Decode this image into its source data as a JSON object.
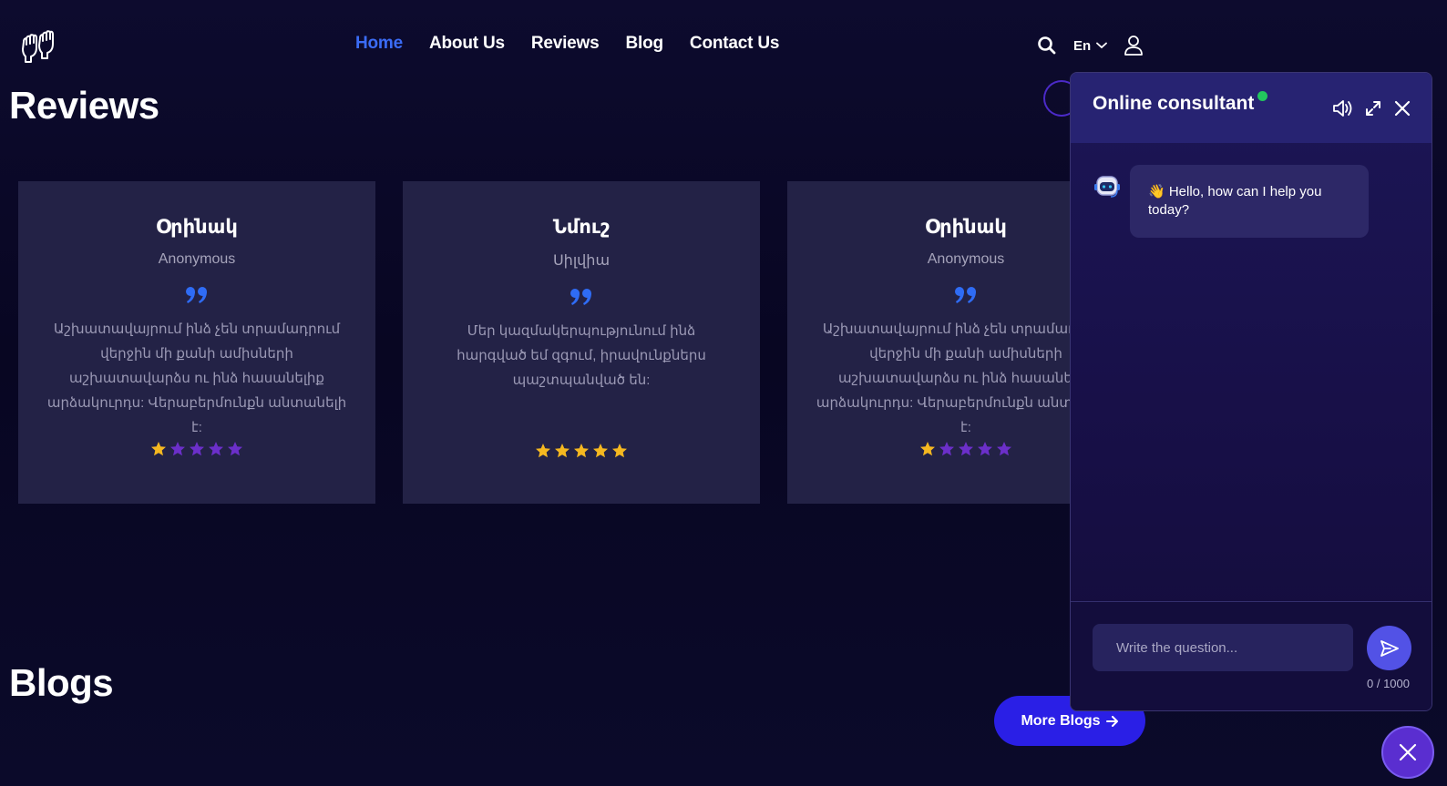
{
  "nav": {
    "items": [
      {
        "label": "Home",
        "active": true
      },
      {
        "label": "About Us",
        "active": false
      },
      {
        "label": "Reviews",
        "active": false
      },
      {
        "label": "Blog",
        "active": false
      },
      {
        "label": "Contact Us",
        "active": false
      }
    ],
    "language": "En",
    "icons": [
      "search-icon",
      "chevron-down-icon",
      "user-icon"
    ]
  },
  "reviews": {
    "title": "Reviews",
    "cards": [
      {
        "name": "Օրինակ",
        "author": "Anonymous",
        "text": "Աշխատավայրում ինձ չեն տրամադրում վերջին մի քանի ամիսների աշխատավարձս ու ինձ հասանելիք արձակուրդս: Վերաբերմունքն անտանելի է:",
        "rating": 1
      },
      {
        "name": "Նմուշ",
        "author": "Սիլվիա",
        "text": "Մեր կազմակերպությունում ինձ հարգված եմ զգում, իրավունքներս պաշտպանված են:",
        "rating": 5
      },
      {
        "name": "Օրինակ",
        "author": "Anonymous",
        "text": "Աշխատավայրում ինձ չեն տրամադրում վերջին մի քանի ամիսների աշխատավարձս ու ինձ հասանելիք արձակուրդս: Վերաբերմունքն անտանելի է:",
        "rating": 1
      }
    ],
    "max_rating": 5
  },
  "blogs": {
    "title": "Blogs",
    "more_label": "More Blogs"
  },
  "chat": {
    "title": "Online consultant",
    "greeting": "👋 Hello, how can I help you today?",
    "input_placeholder": "Write the question...",
    "counter": "0 / 1000"
  },
  "colors": {
    "background": "#0b0a2a",
    "accent": "#3b6cf6",
    "card": "#232246",
    "star_filled": "#f5b820",
    "star_empty": "#6b2fc9",
    "button": "#2a1fe6",
    "online": "#22c55e"
  }
}
